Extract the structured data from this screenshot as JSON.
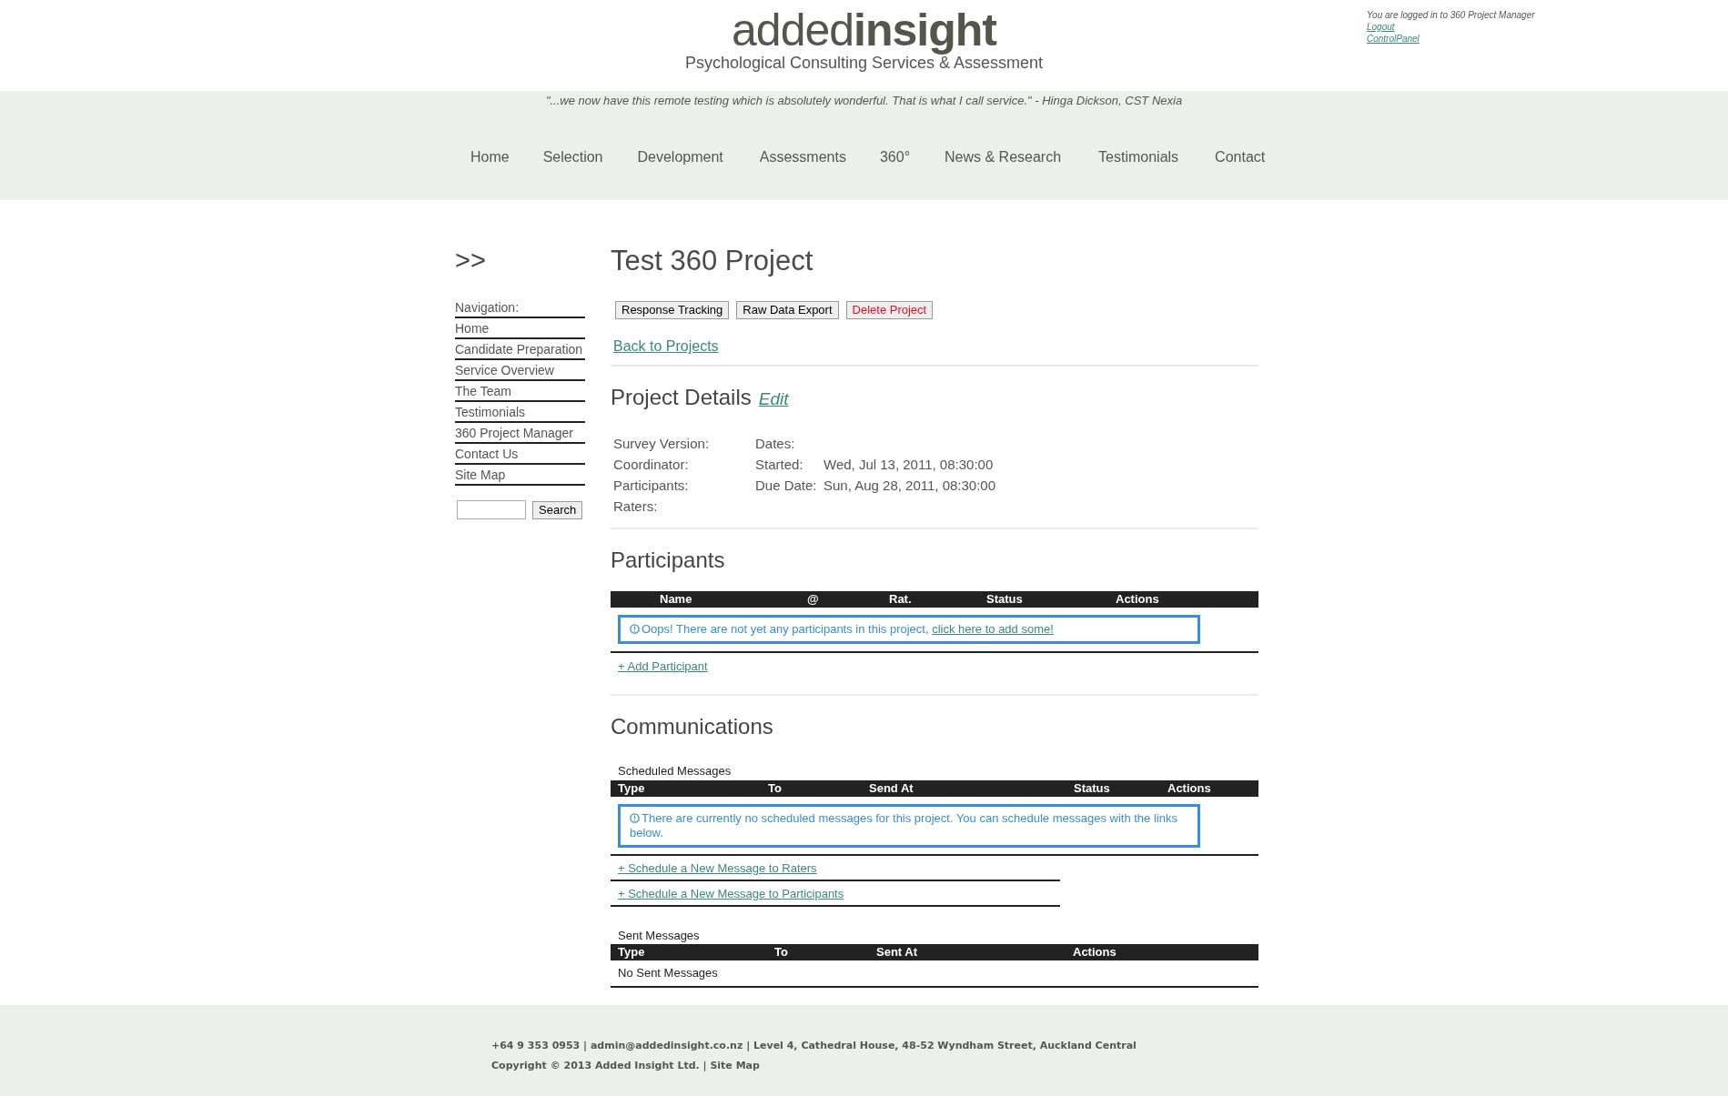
{
  "header": {
    "logo": "added**insight**",
    "tagline": "Psychological Consulting Services & Assessment",
    "login_status": "You are logged in to 360 Project Manager",
    "links": [
      "Logout",
      "ControlPanel"
    ]
  },
  "quote": "\"...we now have this remote testing which is absolutely wonderful. That is what I call service.\" - Hinga Dickson, CST Nexia",
  "main_nav": [
    "Home",
    "Selection",
    "Development",
    "Assessments",
    "360°",
    "News & Research",
    "Testimonials",
    "Contact"
  ],
  "sidebar": {
    "arrow": ">>",
    "heading": "Navigation:",
    "items": [
      "Home",
      "Candidate Preparation",
      "Service Overview",
      "The Team",
      "Testimonials",
      "360 Project Manager",
      "Contact Us",
      "Site Map"
    ],
    "search_button": "Search"
  },
  "project": {
    "title": "Test 360 Project",
    "buttons": [
      {
        "label": "Response Tracking",
        "kind": "normal"
      },
      {
        "label": "Raw Data Export",
        "kind": "normal"
      },
      {
        "label": "Delete Project",
        "kind": "danger"
      }
    ],
    "back_link": "Back to Projects"
  },
  "details": {
    "heading": "Project Details",
    "edit_link": "Edit",
    "labels": [
      "Survey Version:",
      "Coordinator:",
      "Participants:",
      "Raters:"
    ],
    "dates_label": "Dates:",
    "dates": [
      {
        "label": "Started:",
        "value": "Wed, Jul 13, 2011, 08:30:00"
      },
      {
        "label": "Due Date:",
        "value": "Sun, Aug 28, 2011, 08:30:00"
      }
    ]
  },
  "participants": {
    "heading": "Participants",
    "columns": [
      "Name",
      "@",
      "Rat.",
      "Status",
      "Actions"
    ],
    "notice": "Oops! There are not yet any participants in this project, ",
    "notice_link": "click here to add some!",
    "add_link": "+ Add Participant"
  },
  "communications": {
    "heading": "Communications",
    "scheduled": {
      "title": "Scheduled Messages",
      "columns": [
        "Type",
        "To",
        "Send At",
        "Status",
        "Actions"
      ],
      "notice": "There are currently no scheduled messages for this project. You can schedule messages with the links below.",
      "links": [
        "+ Schedule a New Message to Raters",
        "+ Schedule a New Message to Participants"
      ]
    },
    "sent": {
      "title": "Sent Messages",
      "columns": [
        "Type",
        "To",
        "Sent At",
        "Actions"
      ],
      "empty": "No Sent Messages"
    }
  },
  "footer": {
    "contact": "+64 9 353 0953 | admin@addedinsight.co.nz | Level 4, Cathedral House, 48-52 Wyndham Street, Auckland Central",
    "copyright": "Copyright © 2013 Added Insight Ltd. | ",
    "link": "Site Map"
  }
}
